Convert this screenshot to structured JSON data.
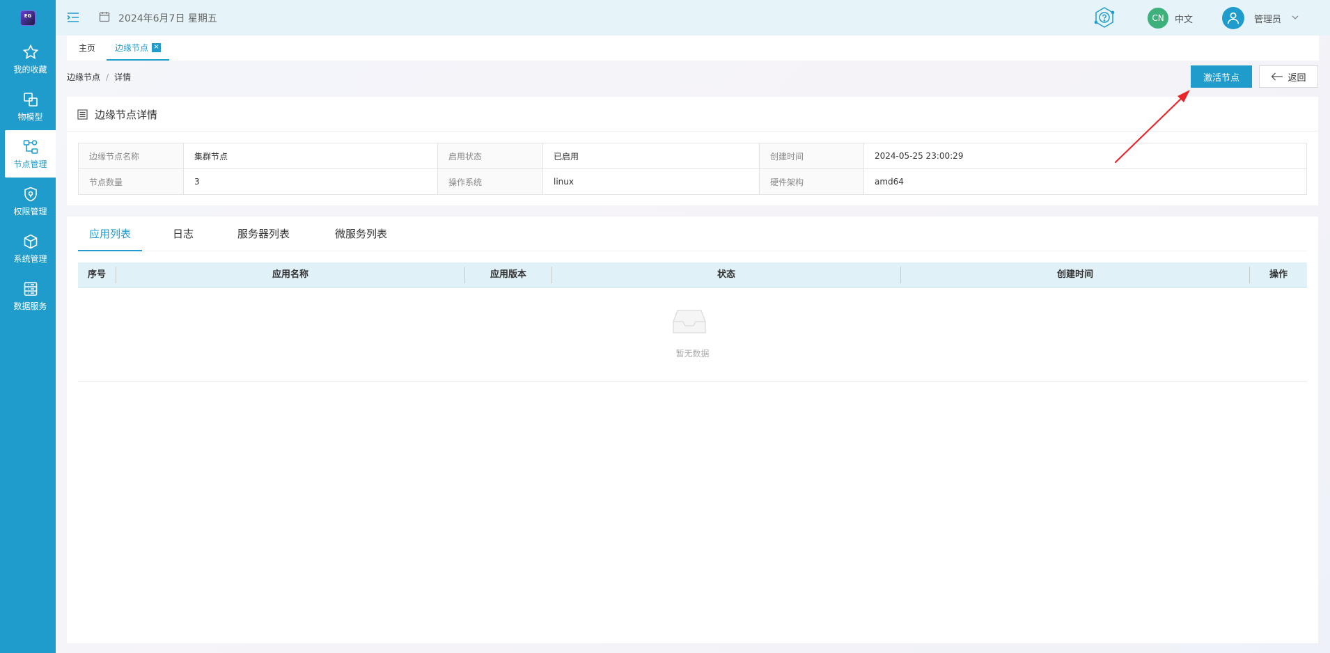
{
  "app": {
    "logo_text": "EG"
  },
  "sidebar": {
    "items": [
      {
        "label": "我的收藏",
        "icon": "star-icon"
      },
      {
        "label": "物模型",
        "icon": "model-icon"
      },
      {
        "label": "节点管理",
        "icon": "node-icon",
        "active": true
      },
      {
        "label": "权限管理",
        "icon": "shield-icon"
      },
      {
        "label": "系统管理",
        "icon": "cube-icon"
      },
      {
        "label": "数据服务",
        "icon": "data-icon"
      }
    ]
  },
  "header": {
    "date": "2024年6月7日 星期五",
    "lang_badge": "CN",
    "lang_label": "中文",
    "user_name": "管理员"
  },
  "tabs": {
    "home": "主页",
    "edge": "边缘节点",
    "close_glyph": "×"
  },
  "breadcrumb": {
    "parent": "边缘节点",
    "separator": "/",
    "current": "详情"
  },
  "actions": {
    "activate": "激活节点",
    "back": "返回"
  },
  "detail": {
    "title": "边缘节点详情",
    "rows": [
      [
        {
          "key": "边缘节点名称",
          "value": "集群节点"
        },
        {
          "key": "启用状态",
          "value": "已启用"
        },
        {
          "key": "创建时间",
          "value": "2024-05-25 23:00:29"
        }
      ],
      [
        {
          "key": "节点数量",
          "value": "3"
        },
        {
          "key": "操作系统",
          "value": "linux"
        },
        {
          "key": "硬件架构",
          "value": "amd64"
        }
      ]
    ]
  },
  "detail_tabs": [
    "应用列表",
    "日志",
    "服务器列表",
    "微服务列表"
  ],
  "grid": {
    "columns": [
      "序号",
      "应用名称",
      "应用版本",
      "状态",
      "创建时间",
      "操作"
    ],
    "empty_text": "暂无数据"
  },
  "colors": {
    "primary": "#1f9ccc",
    "header_bg": "#e6f4fa",
    "lang_badge": "#3eb07c",
    "annotation": "#e8262a"
  }
}
